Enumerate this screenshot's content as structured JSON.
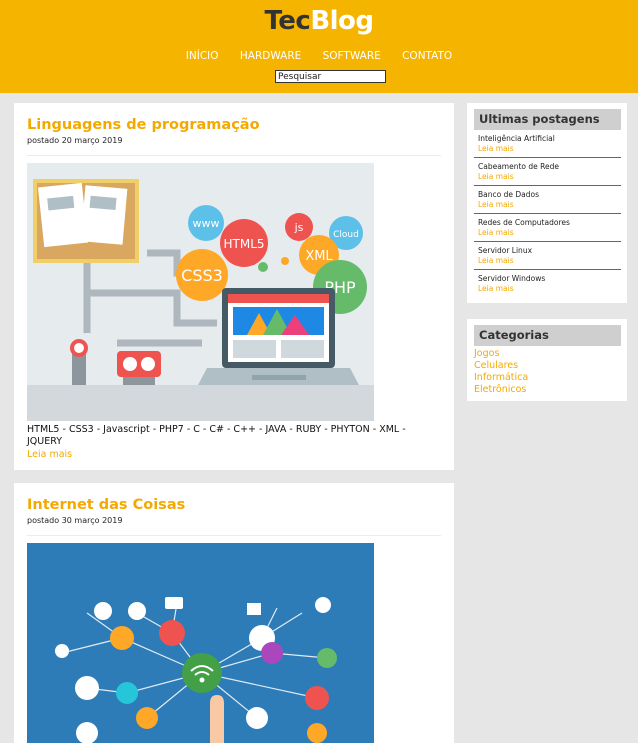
{
  "site": {
    "logo_part1": "Tec",
    "logo_part2": "Blog"
  },
  "nav": [
    {
      "label": "INÍCIO"
    },
    {
      "label": "HARDWARE"
    },
    {
      "label": "SOFTWARE"
    },
    {
      "label": "CONTATO"
    }
  ],
  "search": {
    "value": "Pesquisar"
  },
  "posts": [
    {
      "title": "Linguagens de programação",
      "date": "postado 20 março 2019",
      "text": "HTML5 - CSS3 - Javascript - PHP7 - C - C# - C++ - JAVA - RUBY - PHYTON - XML - JQUERY",
      "read_more": "Leia mais",
      "image_labels": {
        "www": "www",
        "html5": "HTML5",
        "js": "js",
        "cloud": "Cloud",
        "css3": "CSS3",
        "xml": "XML",
        "php": "PHP"
      }
    },
    {
      "title": "Internet das Coisas",
      "date": "postado 30 março 2019"
    }
  ],
  "recent": {
    "title": "Ultimas postagens",
    "items": [
      {
        "title": "Inteligência Artificial",
        "read_more": "Leia mais"
      },
      {
        "title": "Cabeamento de Rede",
        "read_more": "Leia mais"
      },
      {
        "title": "Banco de Dados",
        "read_more": "Leia mais"
      },
      {
        "title": "Redes de Computadores",
        "read_more": "Leia mais"
      },
      {
        "title": "Servidor Linux",
        "read_more": "Leia mais"
      },
      {
        "title": "Servidor Windows",
        "read_more": "Leia mais"
      }
    ]
  },
  "categories": {
    "title": "Categorias",
    "items": [
      {
        "label": "Jogos"
      },
      {
        "label": "Celulares"
      },
      {
        "label": "Informática"
      },
      {
        "label": "Eletrônicos"
      }
    ]
  },
  "colors": {
    "accent": "#f4b400",
    "link": "#f4a900",
    "widget_title_bg": "#cfcfcf",
    "page_bg": "#e6e6e6"
  }
}
